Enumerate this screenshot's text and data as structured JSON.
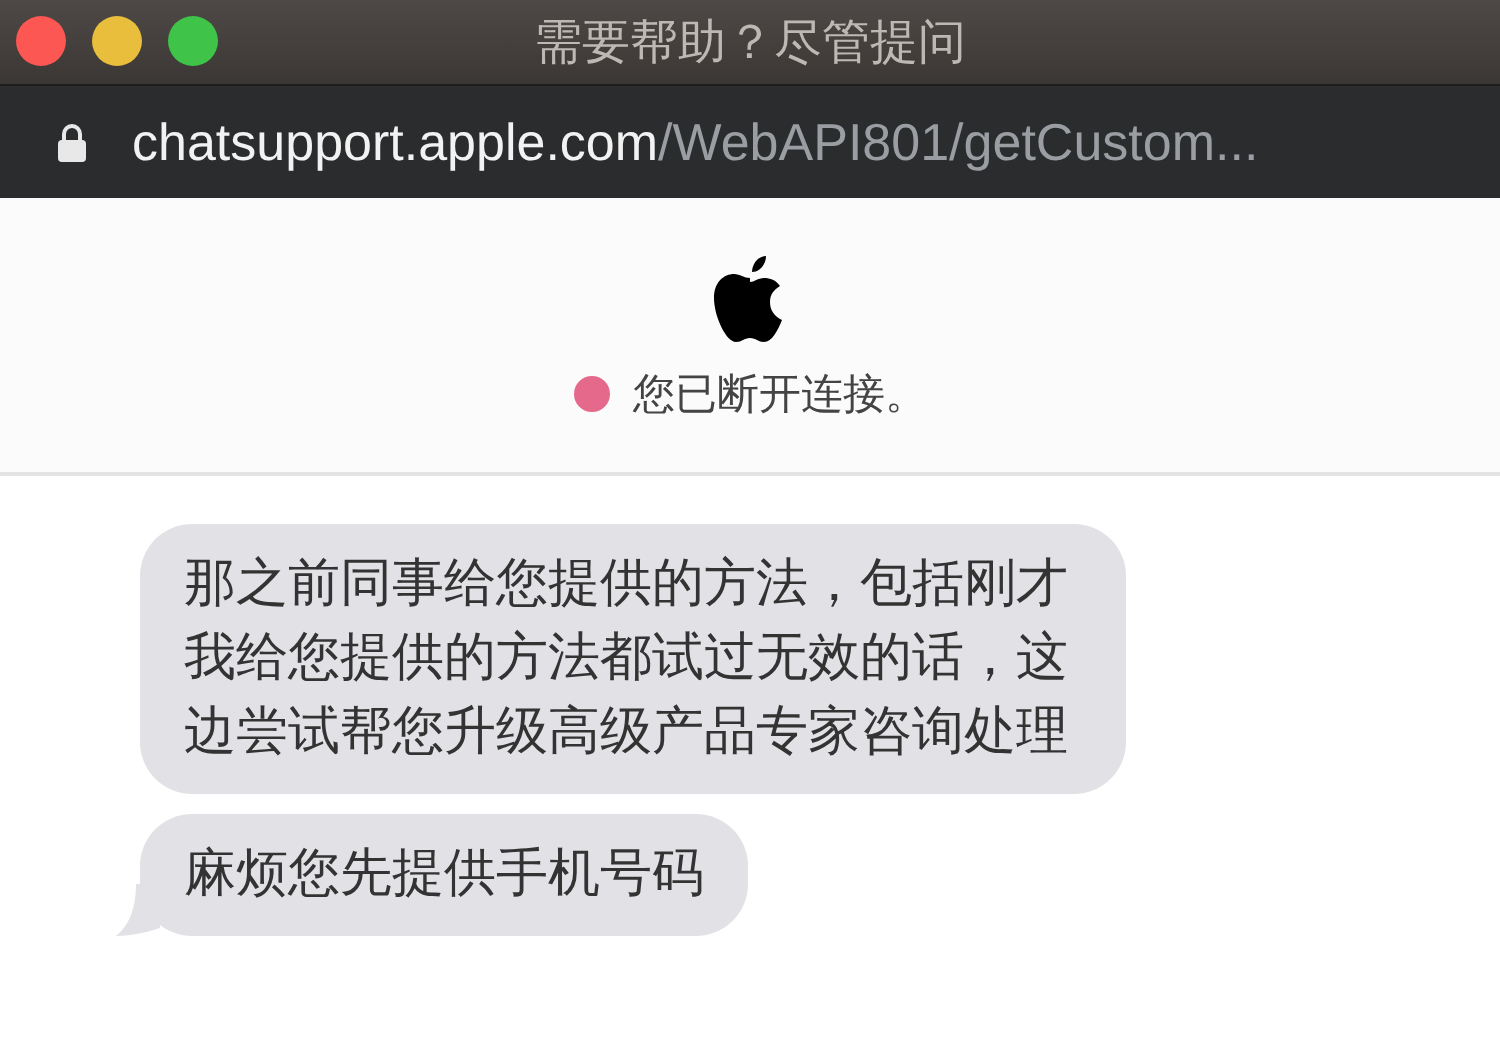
{
  "window": {
    "title": "需要帮助？尽管提问"
  },
  "address_bar": {
    "host": "chatsupport.apple.com",
    "path": "/WebAPI801/getCustom..."
  },
  "status": {
    "text": "您已断开连接。",
    "color": "#e5698a"
  },
  "messages": [
    {
      "text": "那之前同事给您提供的方法，包括刚才我给您提供的方法都试过无效的话，这边尝试帮您升级高级产品专家咨询处理",
      "tail": false
    },
    {
      "text": "麻烦您先提供手机号码",
      "tail": true
    }
  ]
}
